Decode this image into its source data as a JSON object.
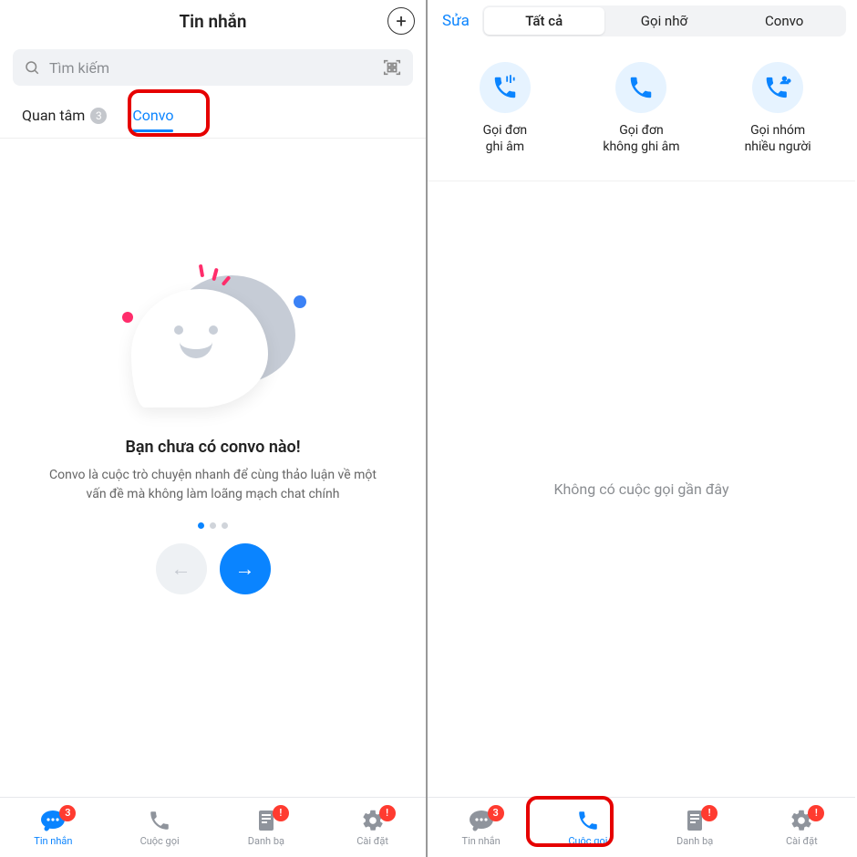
{
  "left": {
    "header": {
      "title": "Tin nhắn"
    },
    "search": {
      "placeholder": "Tìm kiếm"
    },
    "tabs": {
      "care": {
        "label": "Quan tâm",
        "badge": "3"
      },
      "convo": {
        "label": "Convo"
      }
    },
    "empty": {
      "title": "Bạn chưa có convo nào!",
      "subtitle": "Convo là cuộc trò chuyện nhanh để cùng thảo luận về một vấn đề mà không làm loãng mạch chat chính"
    },
    "nav": {
      "messages": {
        "label": "Tin nhắn",
        "badge": "3"
      },
      "calls": {
        "label": "Cuộc gọi"
      },
      "contacts": {
        "label": "Danh bạ"
      },
      "settings": {
        "label": "Cài đặt"
      }
    }
  },
  "right": {
    "edit": "Sửa",
    "segments": {
      "all": "Tất cả",
      "missed": "Gọi nhỡ",
      "convo": "Convo"
    },
    "options": {
      "rec": "Gọi đơn\nghi âm",
      "norec": "Gọi đơn\nkhông ghi âm",
      "group": "Gọi nhóm\nnhiều người"
    },
    "empty": "Không có cuộc gọi gần đây",
    "nav": {
      "messages": {
        "label": "Tin nhắn",
        "badge": "3"
      },
      "calls": {
        "label": "Cuộc gọi"
      },
      "contacts": {
        "label": "Danh bạ"
      },
      "settings": {
        "label": "Cài đặt"
      }
    }
  }
}
